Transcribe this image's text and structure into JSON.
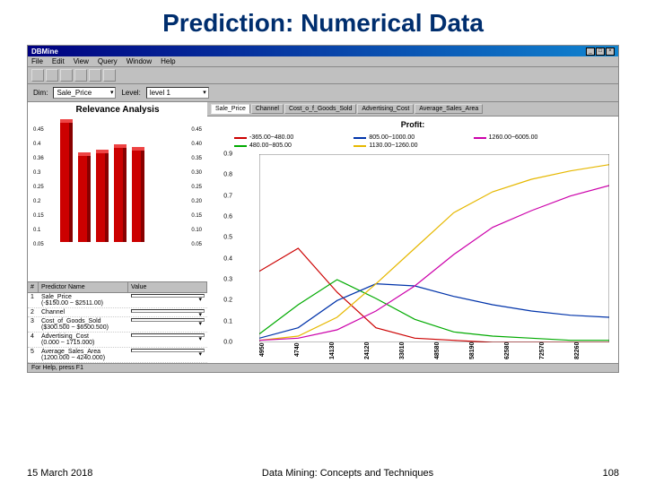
{
  "slide": {
    "title": "Prediction: Numerical Data"
  },
  "window": {
    "title": "DBMine",
    "menus": [
      "File",
      "Edit",
      "View",
      "Query",
      "Window",
      "Help"
    ],
    "dim_label": "Dim:",
    "dim_value": "Sale_Price",
    "level_label": "Level:",
    "level_value": "level 1",
    "tabs": [
      "Sale_Price",
      "Channel",
      "Cost_o_f_Goods_Sold",
      "Advertising_Cost",
      "Average_Sales_Area"
    ],
    "statusbar": "For Help, press F1"
  },
  "relevance": {
    "title": "Relevance Analysis",
    "yticks_left": [
      "0.45",
      "0.4",
      "0.36",
      "0.3",
      "0.25",
      "0.2",
      "0.15",
      "0.1",
      "0.05"
    ],
    "yticks_right": [
      "0.45",
      "0.40",
      "0.35",
      "0.30",
      "0.25",
      "0.20",
      "0.15",
      "0.10",
      "0.05"
    ]
  },
  "predictors": {
    "header": {
      "num": "#",
      "name": "Predictor Name",
      "value": "Value"
    },
    "rows": [
      {
        "n": "1",
        "name": "Sale_Price",
        "desc": "(-$150.00 ~ $2511.00)"
      },
      {
        "n": "2",
        "name": "Channel",
        "desc": ""
      },
      {
        "n": "3",
        "name": "Cost_of_Goods_Sold",
        "desc": "($300.500 ~ $6500.500)"
      },
      {
        "n": "4",
        "name": "Advertising_Cost",
        "desc": "(0.000 ~ 1715.000)"
      },
      {
        "n": "5",
        "name": "Average_Sales_Area",
        "desc": "(1200.000 ~ 4240.000)"
      }
    ]
  },
  "profit": {
    "title": "Profit:",
    "legend": [
      {
        "label": "-365.00~480.00",
        "color": "#cc0000"
      },
      {
        "label": "805.00~1000.00",
        "color": "#0033aa"
      },
      {
        "label": "1260.00~6005.00",
        "color": "#cc00aa"
      },
      {
        "label": "480.00~805.00",
        "color": "#00aa00"
      },
      {
        "label": "1130.00~1260.00",
        "color": "#e6b800"
      }
    ],
    "yticks": [
      "0.9",
      "0.8",
      "0.7",
      "0.6",
      "0.5",
      "0.4",
      "0.3",
      "0.2",
      "0.1",
      "0.0"
    ],
    "xticks": [
      "4950",
      "4740",
      "14130",
      "24120",
      "33010",
      "48580",
      "58190",
      "62580",
      "72570",
      "82260"
    ]
  },
  "chart_data": [
    {
      "type": "bar",
      "title": "Relevance Analysis",
      "categories": [
        "1",
        "2",
        "3",
        "4",
        "5"
      ],
      "values": [
        0.44,
        0.32,
        0.33,
        0.35,
        0.34
      ],
      "ylim": [
        0,
        0.45
      ],
      "ylabel": "",
      "xlabel": ""
    },
    {
      "type": "line",
      "title": "Profit:",
      "xlabel": "",
      "ylabel": "",
      "ylim": [
        0.0,
        0.9
      ],
      "x": [
        4950,
        4740,
        14130,
        24120,
        33010,
        48580,
        58190,
        62580,
        72570,
        82260
      ],
      "series": [
        {
          "name": "-365.00~480.00",
          "color": "#cc0000",
          "values": [
            0.34,
            0.45,
            0.24,
            0.07,
            0.02,
            0.01,
            0.0,
            0.0,
            0.0,
            0.0
          ]
        },
        {
          "name": "480.00~805.00",
          "color": "#00aa00",
          "values": [
            0.04,
            0.18,
            0.3,
            0.21,
            0.11,
            0.05,
            0.03,
            0.02,
            0.01,
            0.01
          ]
        },
        {
          "name": "805.00~1000.00",
          "color": "#0033aa",
          "values": [
            0.02,
            0.07,
            0.2,
            0.28,
            0.27,
            0.22,
            0.18,
            0.15,
            0.13,
            0.12
          ]
        },
        {
          "name": "1130.00~1260.00",
          "color": "#e6b800",
          "values": [
            0.01,
            0.03,
            0.12,
            0.28,
            0.45,
            0.62,
            0.72,
            0.78,
            0.82,
            0.85
          ]
        },
        {
          "name": "1260.00~6005.00",
          "color": "#cc00aa",
          "values": [
            0.01,
            0.02,
            0.06,
            0.15,
            0.27,
            0.42,
            0.55,
            0.63,
            0.7,
            0.75
          ]
        }
      ]
    }
  ],
  "footer": {
    "date": "15 March 2018",
    "course": "Data Mining: Concepts and Techniques",
    "page": "108"
  }
}
